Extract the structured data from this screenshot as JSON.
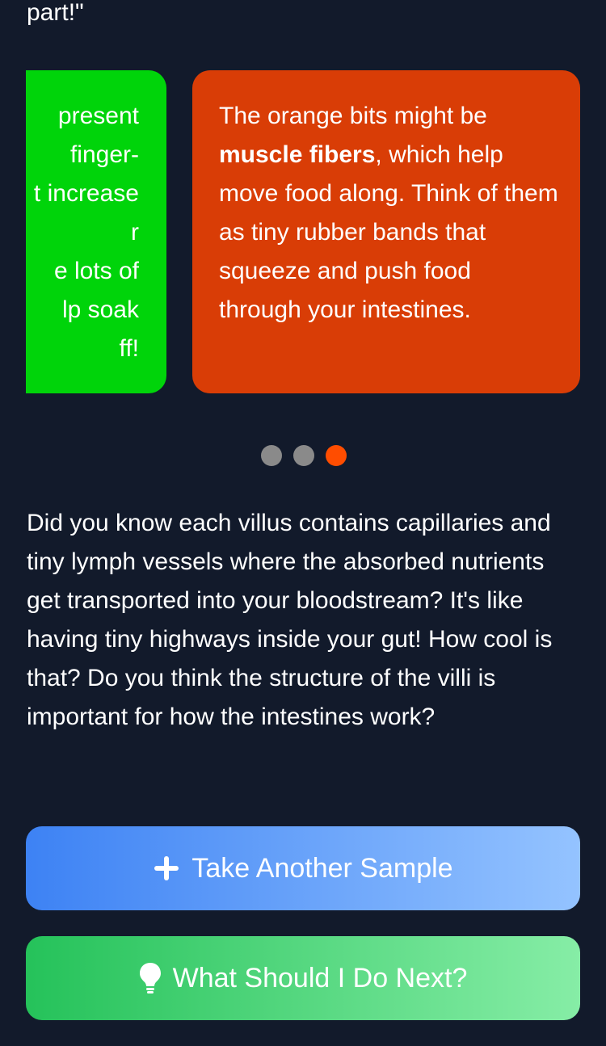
{
  "top_text": "part!\"",
  "cards": [
    {
      "color": "#00d40a",
      "lines": [
        "present",
        "finger-",
        "t increase",
        "r",
        "e lots of",
        "lp soak",
        "ff!"
      ]
    },
    {
      "color": "#d93d06",
      "text_before": "The orange bits might be ",
      "bold": "muscle fibers",
      "text_after": ", which help move food along. Think of them as tiny rubber bands that squeeze and push food through your intestines."
    }
  ],
  "pagination": {
    "count": 3,
    "active_index": 2,
    "active_color": "#ff4d00"
  },
  "paragraph": "Did you know each villus contains capillaries and tiny lymph vessels where the absorbed nutrients get transported into your bloodstream? It's like having tiny highways inside your gut! How cool is that? Do you think the structure of the villi is important for how the intestines work?",
  "buttons": {
    "take_sample": {
      "label": "Take Another Sample",
      "icon": "plus-icon"
    },
    "next_step": {
      "label": "What Should I Do Next?",
      "icon": "lightbulb-icon"
    }
  }
}
